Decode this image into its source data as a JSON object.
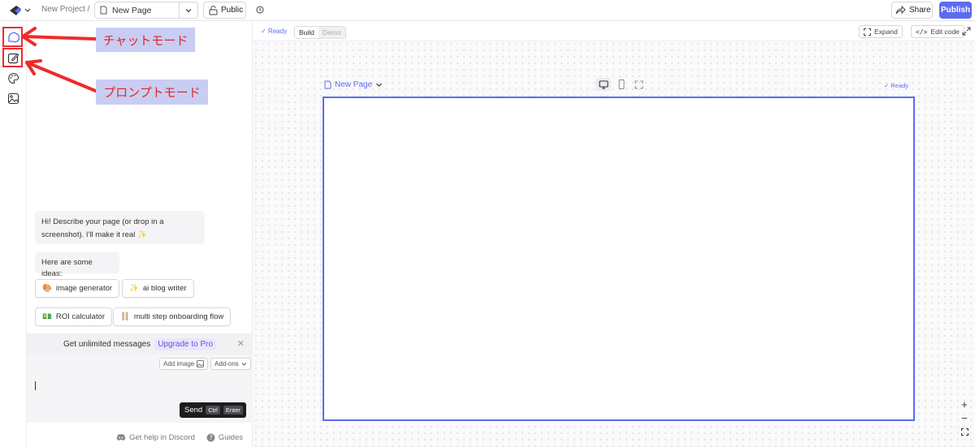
{
  "topbar": {
    "project_crumb": "New Project  /",
    "page_select": "New Page",
    "visibility": "Public",
    "share_label": "Share",
    "publish_label": "Publish"
  },
  "chat": {
    "greeting": "Hi! Describe your page (or drop in a screenshot). I'll make it real ✨",
    "ideas_intro": "Here are some ideas:",
    "suggestions": [
      {
        "emoji": "🎨",
        "label": "image generator"
      },
      {
        "emoji": "✨",
        "label": "ai blog writer"
      },
      {
        "emoji": "💵",
        "label": "ROI calculator"
      },
      {
        "emoji": "🪜",
        "label": "multi step onboarding flow"
      }
    ],
    "upsell_text": "Get unlimited messages",
    "upsell_cta": "Upgrade to Pro",
    "add_image_label": "Add image",
    "addons_label": "Add-ons",
    "send_label": "Send",
    "send_kbd1": "Ctrl",
    "send_kbd2": "Enter",
    "discord_label": "Get help in Discord",
    "guides_label": "Guides"
  },
  "canvas": {
    "status": "Ready",
    "mode_build": "Build",
    "mode_demo": "Demo",
    "expand_label": "Expand",
    "edit_code_label": "Edit code",
    "frame_title": "New Page",
    "frame_status": "Ready"
  },
  "annotations": {
    "chat_mode": "チャットモード",
    "prompt_mode": "プロンプトモード"
  },
  "colors": {
    "accent": "#5b6cf0",
    "annotation_red": "#ee2b2b",
    "annotation_bg": "#c9cdf3"
  }
}
